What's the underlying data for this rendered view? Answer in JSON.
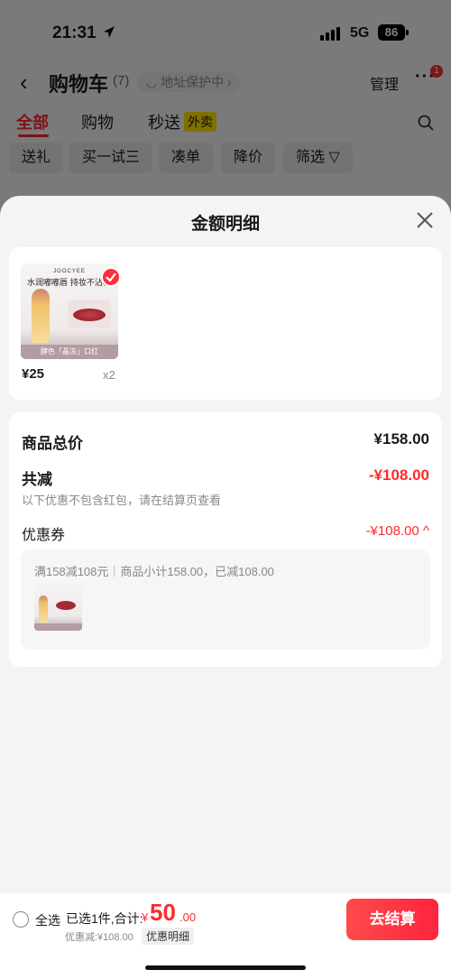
{
  "status_bar": {
    "time": "21:31",
    "network": "5G",
    "battery": "86"
  },
  "nav": {
    "title": "购物车",
    "count": "(7)",
    "address_protect": "◡ 地址保护中 ›",
    "manage": "管理",
    "more": "···",
    "more_badge": "1"
  },
  "tabs": [
    {
      "label": "全部"
    },
    {
      "label": "购物"
    },
    {
      "label": "秒送"
    }
  ],
  "tab_badge": "外卖",
  "chips": [
    {
      "label": "送礼"
    },
    {
      "label": "买一试三"
    },
    {
      "label": "凑单"
    },
    {
      "label": "降价"
    },
    {
      "label": "筛选 ▽"
    }
  ],
  "sheet": {
    "title": "金额明细",
    "product": {
      "brand": "JOOCYEE",
      "thumb_text": "水润嘟嘟唇 持妆不沾杯",
      "thumb_foot": "酵色「晶冻」口红",
      "price": "¥25",
      "qty": "x2"
    },
    "total_label": "商品总价",
    "total_value": "¥158.00",
    "reduce_label": "共减",
    "reduce_value": "-¥108.00",
    "reduce_note": "以下优惠不包含红包，请在结算页查看",
    "coupon_label": "优惠券",
    "coupon_value": "-¥108.00 ^",
    "coupon_desc": "满158减108元｜商品小计158.00，已减108.00"
  },
  "bottom": {
    "select_all": "全选",
    "summary": "已选1件,合计:",
    "currency": "¥",
    "total_int": "50",
    "total_dec": ".00",
    "discount": "优惠减:¥108.00",
    "detail_button": "优惠明细",
    "checkout": "去结算"
  },
  "colors": {
    "accent": "#ff2a2a",
    "checkout": "#ff3344"
  }
}
